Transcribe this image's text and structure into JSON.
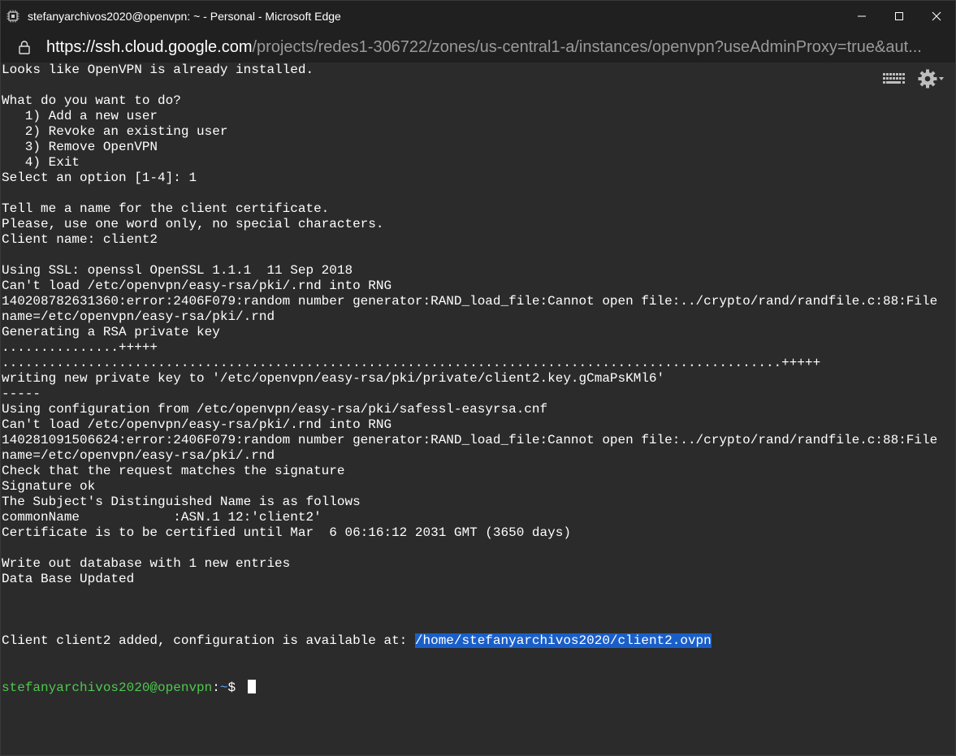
{
  "window": {
    "title": "stefanyarchivos2020@openvpn: ~ - Personal - Microsoft Edge"
  },
  "address": {
    "host": "https://ssh.cloud.google.com",
    "path": "/projects/redes1-306722/zones/us-central1-a/instances/openvpn?useAdminProxy=true&aut..."
  },
  "terminal": {
    "lines": [
      "Looks like OpenVPN is already installed.",
      "",
      "What do you want to do?",
      "   1) Add a new user",
      "   2) Revoke an existing user",
      "   3) Remove OpenVPN",
      "   4) Exit",
      "Select an option [1-4]: 1",
      "",
      "Tell me a name for the client certificate.",
      "Please, use one word only, no special characters.",
      "Client name: client2",
      "",
      "Using SSL: openssl OpenSSL 1.1.1  11 Sep 2018",
      "Can't load /etc/openvpn/easy-rsa/pki/.rnd into RNG",
      "140208782631360:error:2406F079:random number generator:RAND_load_file:Cannot open file:../crypto/rand/randfile.c:88:File",
      "name=/etc/openvpn/easy-rsa/pki/.rnd",
      "Generating a RSA private key",
      "...............+++++",
      "....................................................................................................+++++",
      "writing new private key to '/etc/openvpn/easy-rsa/pki/private/client2.key.gCmaPsKMl6'",
      "-----",
      "Using configuration from /etc/openvpn/easy-rsa/pki/safessl-easyrsa.cnf",
      "Can't load /etc/openvpn/easy-rsa/pki/.rnd into RNG",
      "140281091506624:error:2406F079:random number generator:RAND_load_file:Cannot open file:../crypto/rand/randfile.c:88:File",
      "name=/etc/openvpn/easy-rsa/pki/.rnd",
      "Check that the request matches the signature",
      "Signature ok",
      "The Subject's Distinguished Name is as follows",
      "commonName            :ASN.1 12:'client2'",
      "Certificate is to be certified until Mar  6 06:16:12 2031 GMT (3650 days)",
      "",
      "Write out database with 1 new entries",
      "Data Base Updated",
      ""
    ],
    "final_line_prefix": "Client client2 added, configuration is available at: ",
    "final_line_selected": "/home/stefanyarchivos2020/client2.ovpn",
    "prompt_user": "stefanyarchivos2020@openvpn",
    "prompt_sep": ":",
    "prompt_path": "~",
    "prompt_symbol": "$ "
  },
  "colors": {
    "terminal_bg": "#2b2b2b",
    "prompt_user": "#4ec84e",
    "prompt_path": "#5aa6ff",
    "selection": "#1a5fc9"
  },
  "icons": {
    "keyboard": "keyboard-icon",
    "settings": "gear-icon"
  }
}
